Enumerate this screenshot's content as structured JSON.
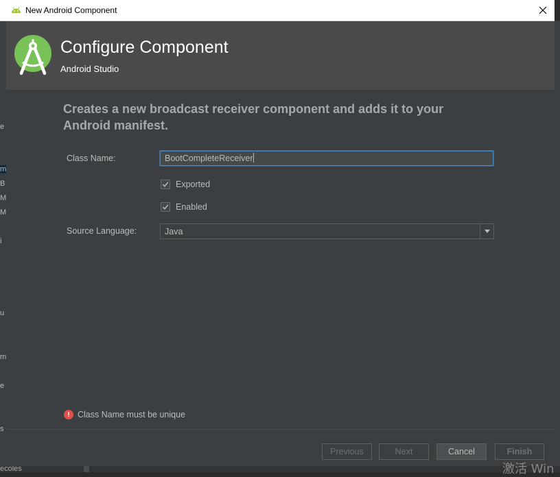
{
  "window": {
    "title": "New Android Component"
  },
  "header": {
    "title": "Configure Component",
    "subtitle": "Android Studio"
  },
  "description": "Creates a new broadcast receiver component and adds it to your Android manifest.",
  "form": {
    "class_name_label": "Class Name:",
    "class_name_value": "BootCompleteReceiver",
    "exported_label": "Exported",
    "exported_checked": true,
    "enabled_label": "Enabled",
    "enabled_checked": true,
    "source_language_label": "Source Language:",
    "source_language_value": "Java"
  },
  "validation": {
    "message": "Class Name must be unique"
  },
  "buttons": {
    "previous": "Previous",
    "next": "Next",
    "cancel": "Cancel",
    "finish": "Finish"
  },
  "background": {
    "left_fragments": [
      "e",
      "m",
      "B",
      "M",
      "M",
      "i",
      "u",
      "m",
      "e",
      "s"
    ],
    "bottom_fragment": "ecoles",
    "watermark": "激活 Win"
  },
  "colors": {
    "android_green": "#a4c639",
    "focus_blue": "#4a88c7",
    "error_red": "#e0514d"
  }
}
